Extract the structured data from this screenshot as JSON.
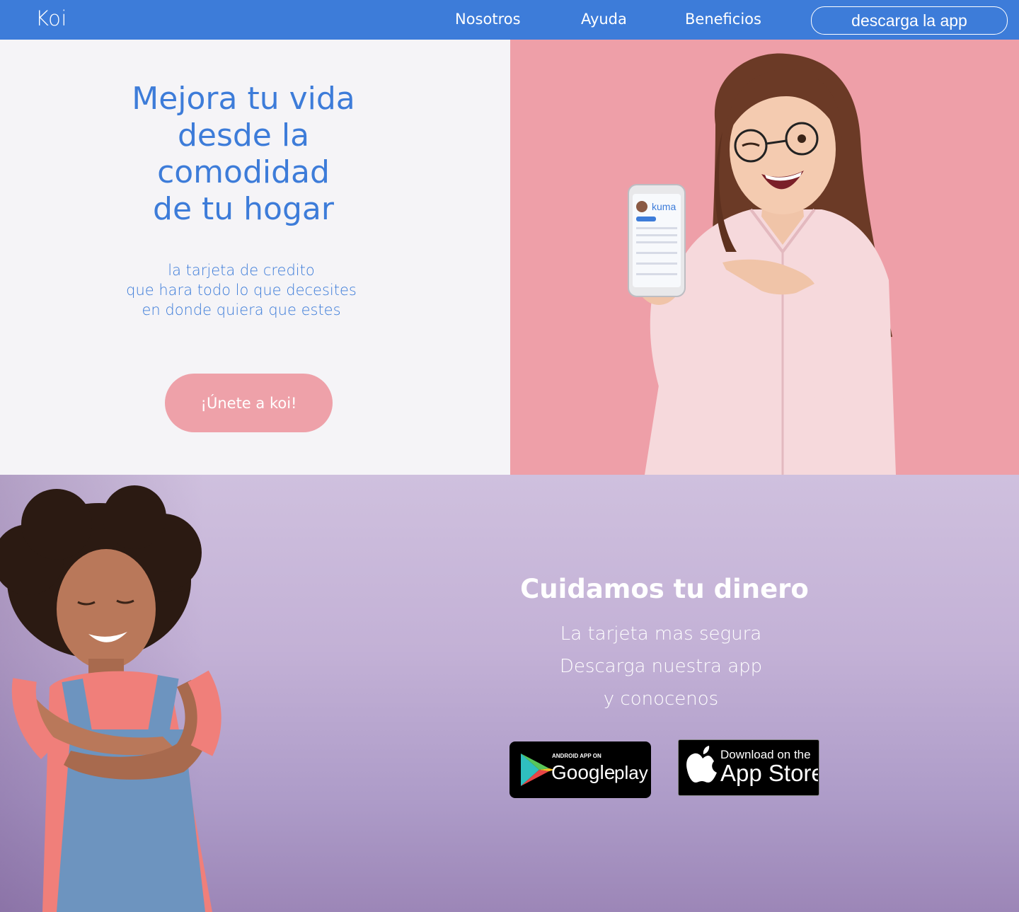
{
  "header": {
    "brand": "Koi",
    "nav": [
      "Nosotros",
      "Ayuda",
      "Beneficios"
    ],
    "download_label": "descarga la app"
  },
  "hero": {
    "title_lines": [
      "Mejora tu vida",
      "desde la",
      "comodidad",
      "de tu hogar"
    ],
    "subtitle_lines": [
      "la tarjeta de credito",
      "que hara todo lo que decesites",
      "en donde quiera que estes"
    ],
    "cta_label": "¡Únete a koi!",
    "phone_app_name": "kuma"
  },
  "section2": {
    "title": "Cuidamos tu dinero",
    "lines": [
      "La tarjeta mas segura",
      "Descarga nuestra app",
      "y conocenos"
    ]
  },
  "badges": {
    "google": {
      "small": "ANDROID APP ON",
      "brand": "Google",
      "word": "play"
    },
    "apple": {
      "small": "Download on the",
      "big": "App Store"
    }
  },
  "colors": {
    "primary": "#3d7cd9",
    "pink": "#ee9fa8",
    "button_pink": "#eea1a9",
    "lavender": "#c3b1d6"
  }
}
